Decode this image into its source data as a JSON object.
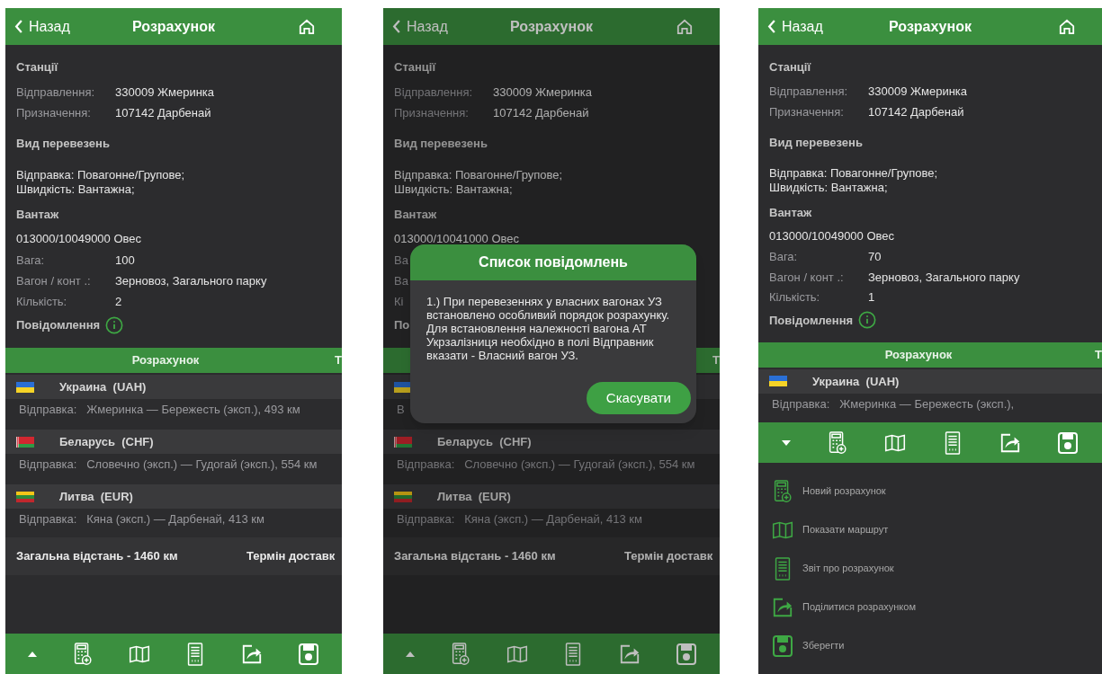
{
  "screens": [
    {
      "dimmed": false,
      "header": {
        "back": "Назад",
        "title": "Розрахунок"
      },
      "stations": {
        "heading": "Станції",
        "rows": [
          {
            "label": "Відправлення:",
            "value": "330009 Жмеринка"
          },
          {
            "label": "Призначення:",
            "value": "107142 Дарбенай"
          }
        ]
      },
      "transport": {
        "heading": "Вид перевезень",
        "lines": [
          "Відправка: Повагонне/Групове;",
          "Швидкість: Вантажна;"
        ]
      },
      "cargo": {
        "heading": "Вантаж",
        "code": "013000/10049000 Овес",
        "rows": [
          {
            "label": "Вага:",
            "value": "100"
          },
          {
            "label": "Вагон / конт .:",
            "value": "Зерновоз, Загального парку"
          },
          {
            "label": "Кількість:",
            "value": "2"
          }
        ]
      },
      "messages": {
        "label": "Повідомлення",
        "info_icon": true
      },
      "tabs": [
        {
          "label": "Розрахунок"
        },
        {
          "label": "Т"
        }
      ],
      "countries": [
        {
          "kind": "ua",
          "name": "Украина  (UAH)",
          "route": "Відправка:   Жмеринка — Бережесть (эксп.), 493 км"
        },
        {
          "kind": "by",
          "name": "Беларусь  (CHF)",
          "route": "Відправка:   Словечно (эксп.) — Гудогай (эксп.), 554 км"
        },
        {
          "kind": "lt",
          "name": "Литва  (EUR)",
          "route": "Відправка:   Кяна (эксп.) — Дарбенай, 413 км"
        }
      ],
      "total": {
        "distance": "Загальна відстань - 1460 км",
        "delivery": "Термін доставк"
      },
      "toolbar": {
        "expanded": false,
        "buttons": [
          {
            "kind": "calculator"
          },
          {
            "kind": "map"
          },
          {
            "kind": "report"
          },
          {
            "kind": "share"
          },
          {
            "kind": "save"
          }
        ]
      }
    },
    {
      "dimmed": true,
      "header": {
        "back": "Назад",
        "title": "Розрахунок"
      },
      "stations": {
        "heading": "Станції",
        "rows": [
          {
            "label": "Відправлення:",
            "value": "330009 Жмеринка"
          },
          {
            "label": "Призначення:",
            "value": "107142 Дарбенай"
          }
        ]
      },
      "transport": {
        "heading": "Вид перевезень",
        "lines": [
          "Відправка: Повагонне/Групове;",
          "Швидкість: Вантажна;"
        ]
      },
      "cargo": {
        "heading": "Вантаж",
        "code": "013000/10041000 Овес",
        "rows": [
          {
            "label": "Ва"
          },
          {
            "label": "Ва"
          },
          {
            "label": "Кі"
          }
        ]
      },
      "messages": {
        "label": "По",
        "info_icon": false
      },
      "tabs": [
        {
          "label": "Т"
        }
      ],
      "countries": [
        {
          "kind": "ua",
          "route": "В"
        },
        {
          "kind": "by",
          "name": "Беларусь  (CHF)",
          "route": "Відправка:   Словечно (эксп.) — Гудогай (эксп.), 554 км"
        },
        {
          "kind": "lt",
          "name": "Литва  (EUR)",
          "route": "Відправка:   Кяна (эксп.) — Дарбенай, 413 км"
        }
      ],
      "total": {
        "distance": "Загальна відстань - 1460 км",
        "delivery": "Термін доставк"
      },
      "toolbar": {
        "expanded": false,
        "buttons": [
          {
            "kind": "calculator"
          },
          {
            "kind": "map"
          },
          {
            "kind": "report"
          },
          {
            "kind": "share"
          },
          {
            "kind": "save"
          }
        ]
      },
      "dialog": {
        "title": "Список повідомлень",
        "text": "1.) При перевезеннях у власних вагонах УЗ встановлено особливий порядок розрахунку. Для встановлення належності вагона АТ Укрзалізниця необхідно в полі Відправник вказати - Власний вагон УЗ.",
        "button": "Скасувати"
      }
    },
    {
      "dimmed": false,
      "header": {
        "back": "Назад",
        "title": "Розрахунок"
      },
      "stations": {
        "heading": "Станції",
        "rows": [
          {
            "label": "Відправлення:",
            "value": "330009 Жмеринка"
          },
          {
            "label": "Призначення:",
            "value": "107142 Дарбенай"
          }
        ]
      },
      "transport": {
        "heading": "Вид перевезень",
        "lines": [
          "Відправка: Повагонне/Групове;",
          "Швидкість: Вантажна;"
        ]
      },
      "cargo": {
        "heading": "Вантаж",
        "code": "013000/10049000 Овес",
        "rows": [
          {
            "label": "Вага:",
            "value": "70"
          },
          {
            "label": "Вагон / конт .:",
            "value": "Зерновоз, Загального парку"
          },
          {
            "label": "Кількість:",
            "value": "1"
          }
        ]
      },
      "messages": {
        "label": "Повідомлення",
        "info_icon": true
      },
      "tabs": [
        {
          "label": "Розрахунок"
        },
        {
          "label": "Т"
        }
      ],
      "countries": [
        {
          "kind": "ua",
          "name": "Украина  (UAH)",
          "route": "Відправка:   Жмеринка — Бережесть (эксп.),"
        }
      ],
      "toolbar": {
        "expanded": true,
        "buttons": [
          {
            "kind": "calculator"
          },
          {
            "kind": "map"
          },
          {
            "kind": "report"
          },
          {
            "kind": "share"
          },
          {
            "kind": "save"
          }
        ]
      },
      "menu": [
        {
          "kind": "calculator",
          "label": "Новий розрахунок"
        },
        {
          "kind": "map",
          "label": "Показати маршрут"
        },
        {
          "kind": "report",
          "label": "Звіт про розрахунок"
        },
        {
          "kind": "share",
          "label": "Поділитися розрахунком"
        },
        {
          "kind": "save",
          "label": "Зберегти"
        }
      ]
    }
  ]
}
